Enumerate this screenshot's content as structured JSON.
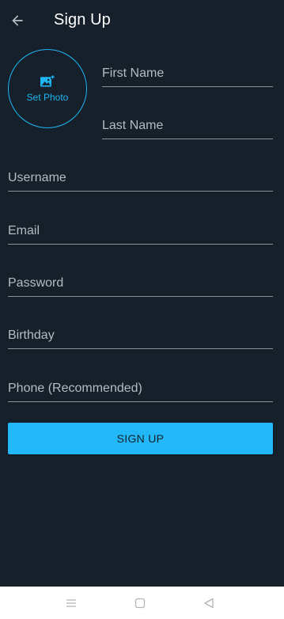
{
  "header": {
    "title": "Sign Up",
    "back_icon": "arrow-left-icon"
  },
  "photo": {
    "label": "Set Photo",
    "icon": "add-photo-icon"
  },
  "form": {
    "first_name": {
      "placeholder": "First Name",
      "value": ""
    },
    "last_name": {
      "placeholder": "Last Name",
      "value": ""
    },
    "username": {
      "placeholder": "Username",
      "value": ""
    },
    "email": {
      "placeholder": "Email",
      "value": ""
    },
    "password": {
      "placeholder": "Password",
      "value": ""
    },
    "birthday": {
      "placeholder": "Birthday",
      "value": ""
    },
    "phone": {
      "placeholder": "Phone (Recommended)",
      "value": ""
    }
  },
  "submit": {
    "label": "SIGN UP"
  },
  "navbar": {
    "items": [
      "menu-icon",
      "home-square-icon",
      "back-triangle-icon"
    ]
  },
  "colors": {
    "background": "#15202b",
    "accent": "#22b8f8",
    "underline": "#8a939c",
    "placeholder": "#b4bcc4",
    "navbar": "#ffffff"
  }
}
